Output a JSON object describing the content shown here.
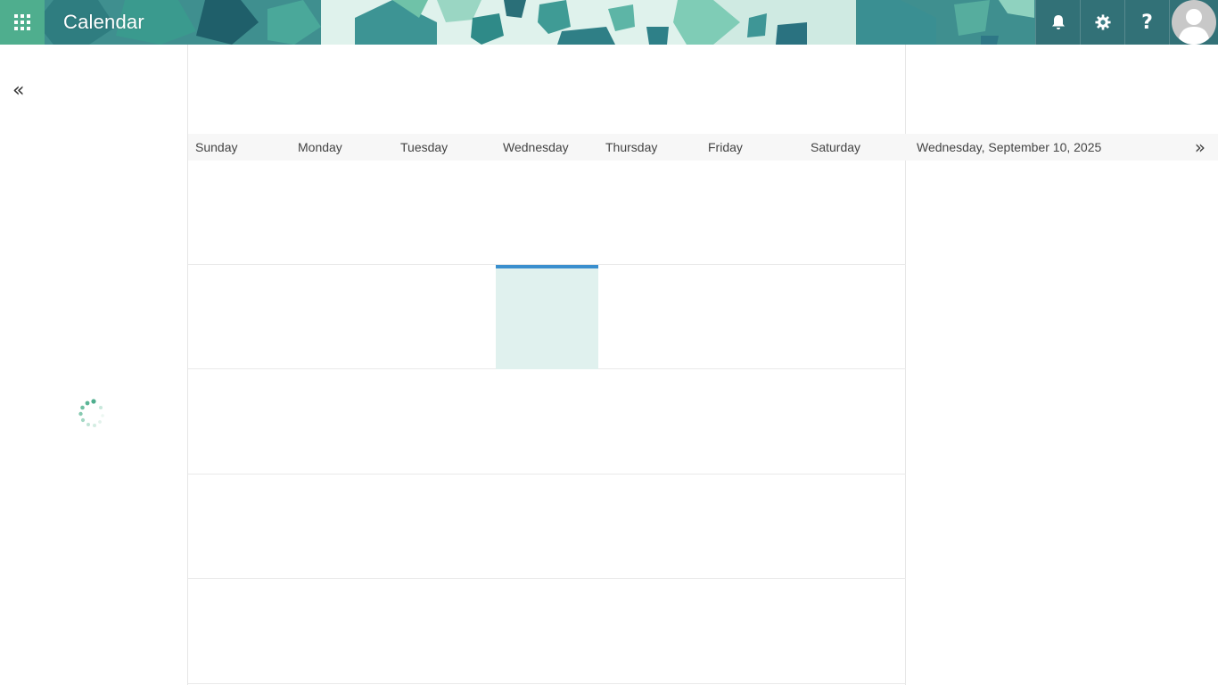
{
  "header": {
    "app_title": "Calendar",
    "waffle_icon": "app-launcher-icon",
    "notifications_icon": "bell-icon",
    "settings_icon": "gear-icon",
    "help_label": "?",
    "avatar_icon": "user-avatar-icon",
    "colors": {
      "accent": "#4fae8e",
      "banner": "#3f8f8f",
      "today_bar": "#3a8fce",
      "today_fill": "#e0f1ee"
    }
  },
  "left_rail": {
    "collapse_label": "«",
    "loading_icon": "spinner-icon"
  },
  "calendar": {
    "weekdays": [
      "Sunday",
      "Monday",
      "Tuesday",
      "Wednesday",
      "Thursday",
      "Friday",
      "Saturday"
    ],
    "today_column": 3,
    "today_week": 1,
    "weeks": 5
  },
  "agenda": {
    "selected_date": "Wednesday, September 10, 2025",
    "expand_label": "»"
  }
}
